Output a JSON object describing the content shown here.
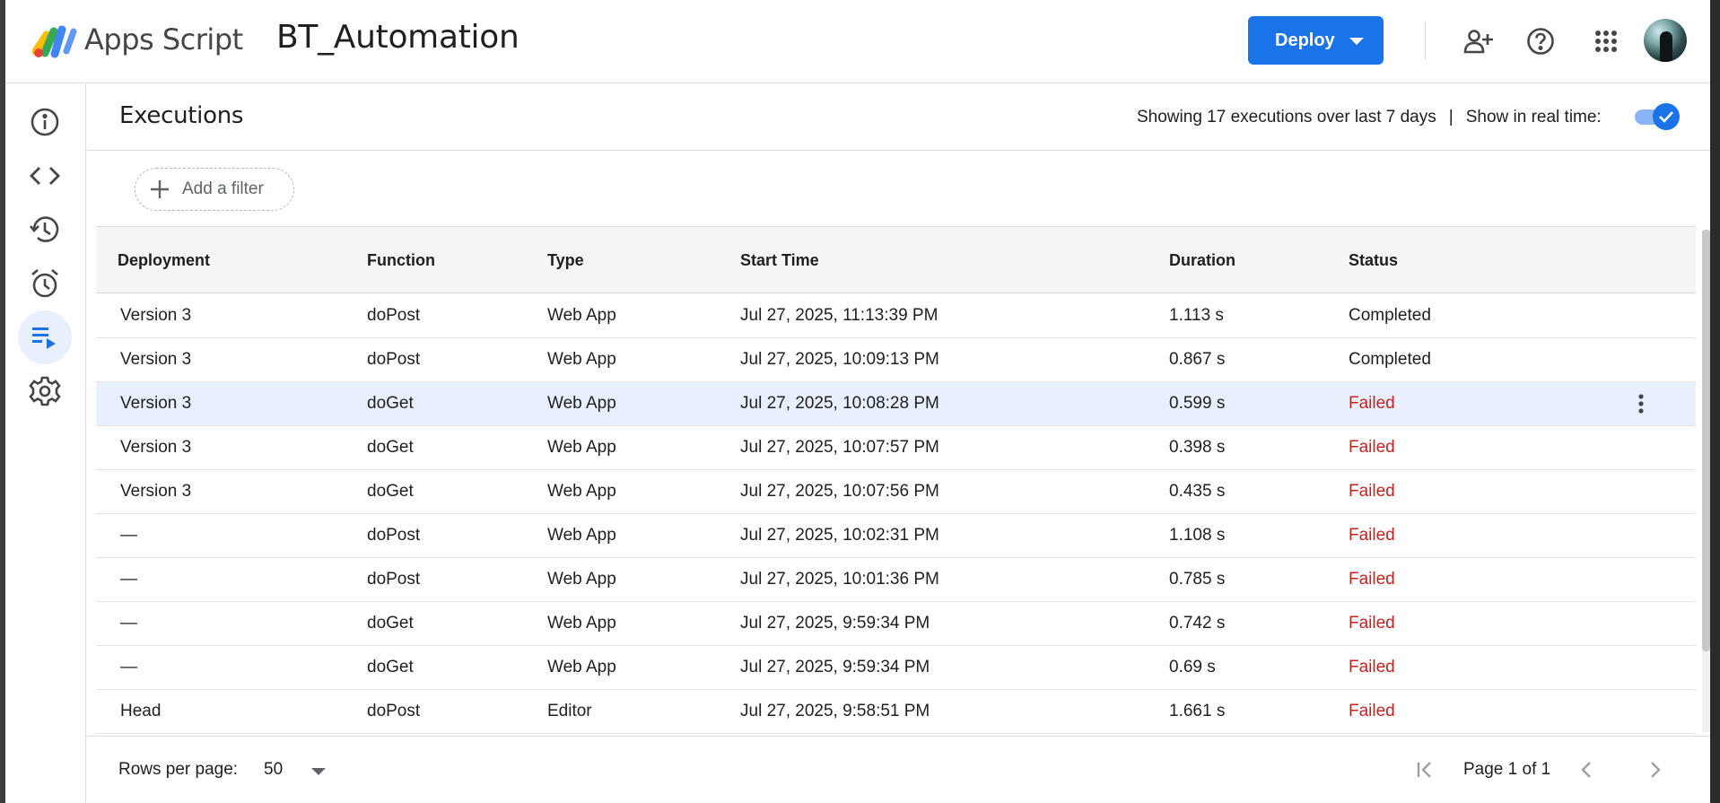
{
  "header": {
    "app_name": "Apps Script",
    "project_name": "BT_Automation",
    "deploy_label": "Deploy",
    "icons": [
      "apps-script-logo",
      "add-person-icon",
      "help-icon",
      "apps-grid-icon",
      "avatar"
    ]
  },
  "sidebar": {
    "items": [
      {
        "name": "overview",
        "icon": "info-icon"
      },
      {
        "name": "editor",
        "icon": "code-icon"
      },
      {
        "name": "project-history",
        "icon": "history-icon"
      },
      {
        "name": "triggers",
        "icon": "alarm-icon"
      },
      {
        "name": "executions",
        "icon": "executions-icon",
        "active": true
      },
      {
        "name": "project-settings",
        "icon": "gear-icon"
      }
    ]
  },
  "executions": {
    "title": "Executions",
    "summary": "Showing 17 executions over last 7 days",
    "realtime_label": "Show in real time:",
    "realtime_on": true,
    "filter_label": "Add a filter"
  },
  "table": {
    "columns": [
      "Deployment",
      "Function",
      "Type",
      "Start Time",
      "Duration",
      "Status"
    ],
    "rows": [
      {
        "deployment": "Version 3",
        "function": "doPost",
        "type": "Web App",
        "start": "Jul 27, 2025, 11:13:39 PM",
        "duration": "1.113 s",
        "status": "Completed"
      },
      {
        "deployment": "Version 3",
        "function": "doPost",
        "type": "Web App",
        "start": "Jul 27, 2025, 10:09:13 PM",
        "duration": "0.867 s",
        "status": "Completed"
      },
      {
        "deployment": "Version 3",
        "function": "doGet",
        "type": "Web App",
        "start": "Jul 27, 2025, 10:08:28 PM",
        "duration": "0.599 s",
        "status": "Failed"
      },
      {
        "deployment": "Version 3",
        "function": "doGet",
        "type": "Web App",
        "start": "Jul 27, 2025, 10:07:57 PM",
        "duration": "0.398 s",
        "status": "Failed"
      },
      {
        "deployment": "Version 3",
        "function": "doGet",
        "type": "Web App",
        "start": "Jul 27, 2025, 10:07:56 PM",
        "duration": "0.435 s",
        "status": "Failed"
      },
      {
        "deployment": "—",
        "function": "doPost",
        "type": "Web App",
        "start": "Jul 27, 2025, 10:02:31 PM",
        "duration": "1.108 s",
        "status": "Failed"
      },
      {
        "deployment": "—",
        "function": "doPost",
        "type": "Web App",
        "start": "Jul 27, 2025, 10:01:36 PM",
        "duration": "0.785 s",
        "status": "Failed"
      },
      {
        "deployment": "—",
        "function": "doGet",
        "type": "Web App",
        "start": "Jul 27, 2025, 9:59:34 PM",
        "duration": "0.742 s",
        "status": "Failed"
      },
      {
        "deployment": "—",
        "function": "doGet",
        "type": "Web App",
        "start": "Jul 27, 2025, 9:59:34 PM",
        "duration": "0.69 s",
        "status": "Failed"
      },
      {
        "deployment": "Head",
        "function": "doPost",
        "type": "Editor",
        "start": "Jul 27, 2025, 9:58:51 PM",
        "duration": "1.661 s",
        "status": "Failed"
      }
    ],
    "selected_row": 2
  },
  "footer": {
    "rows_per_page_label": "Rows per page:",
    "rows_per_page_value": "50",
    "page_label": "Page 1 of 1"
  },
  "colors": {
    "accent": "#1a73e8",
    "failed": "#c5221f",
    "selected_row": "#e8f0fe"
  }
}
